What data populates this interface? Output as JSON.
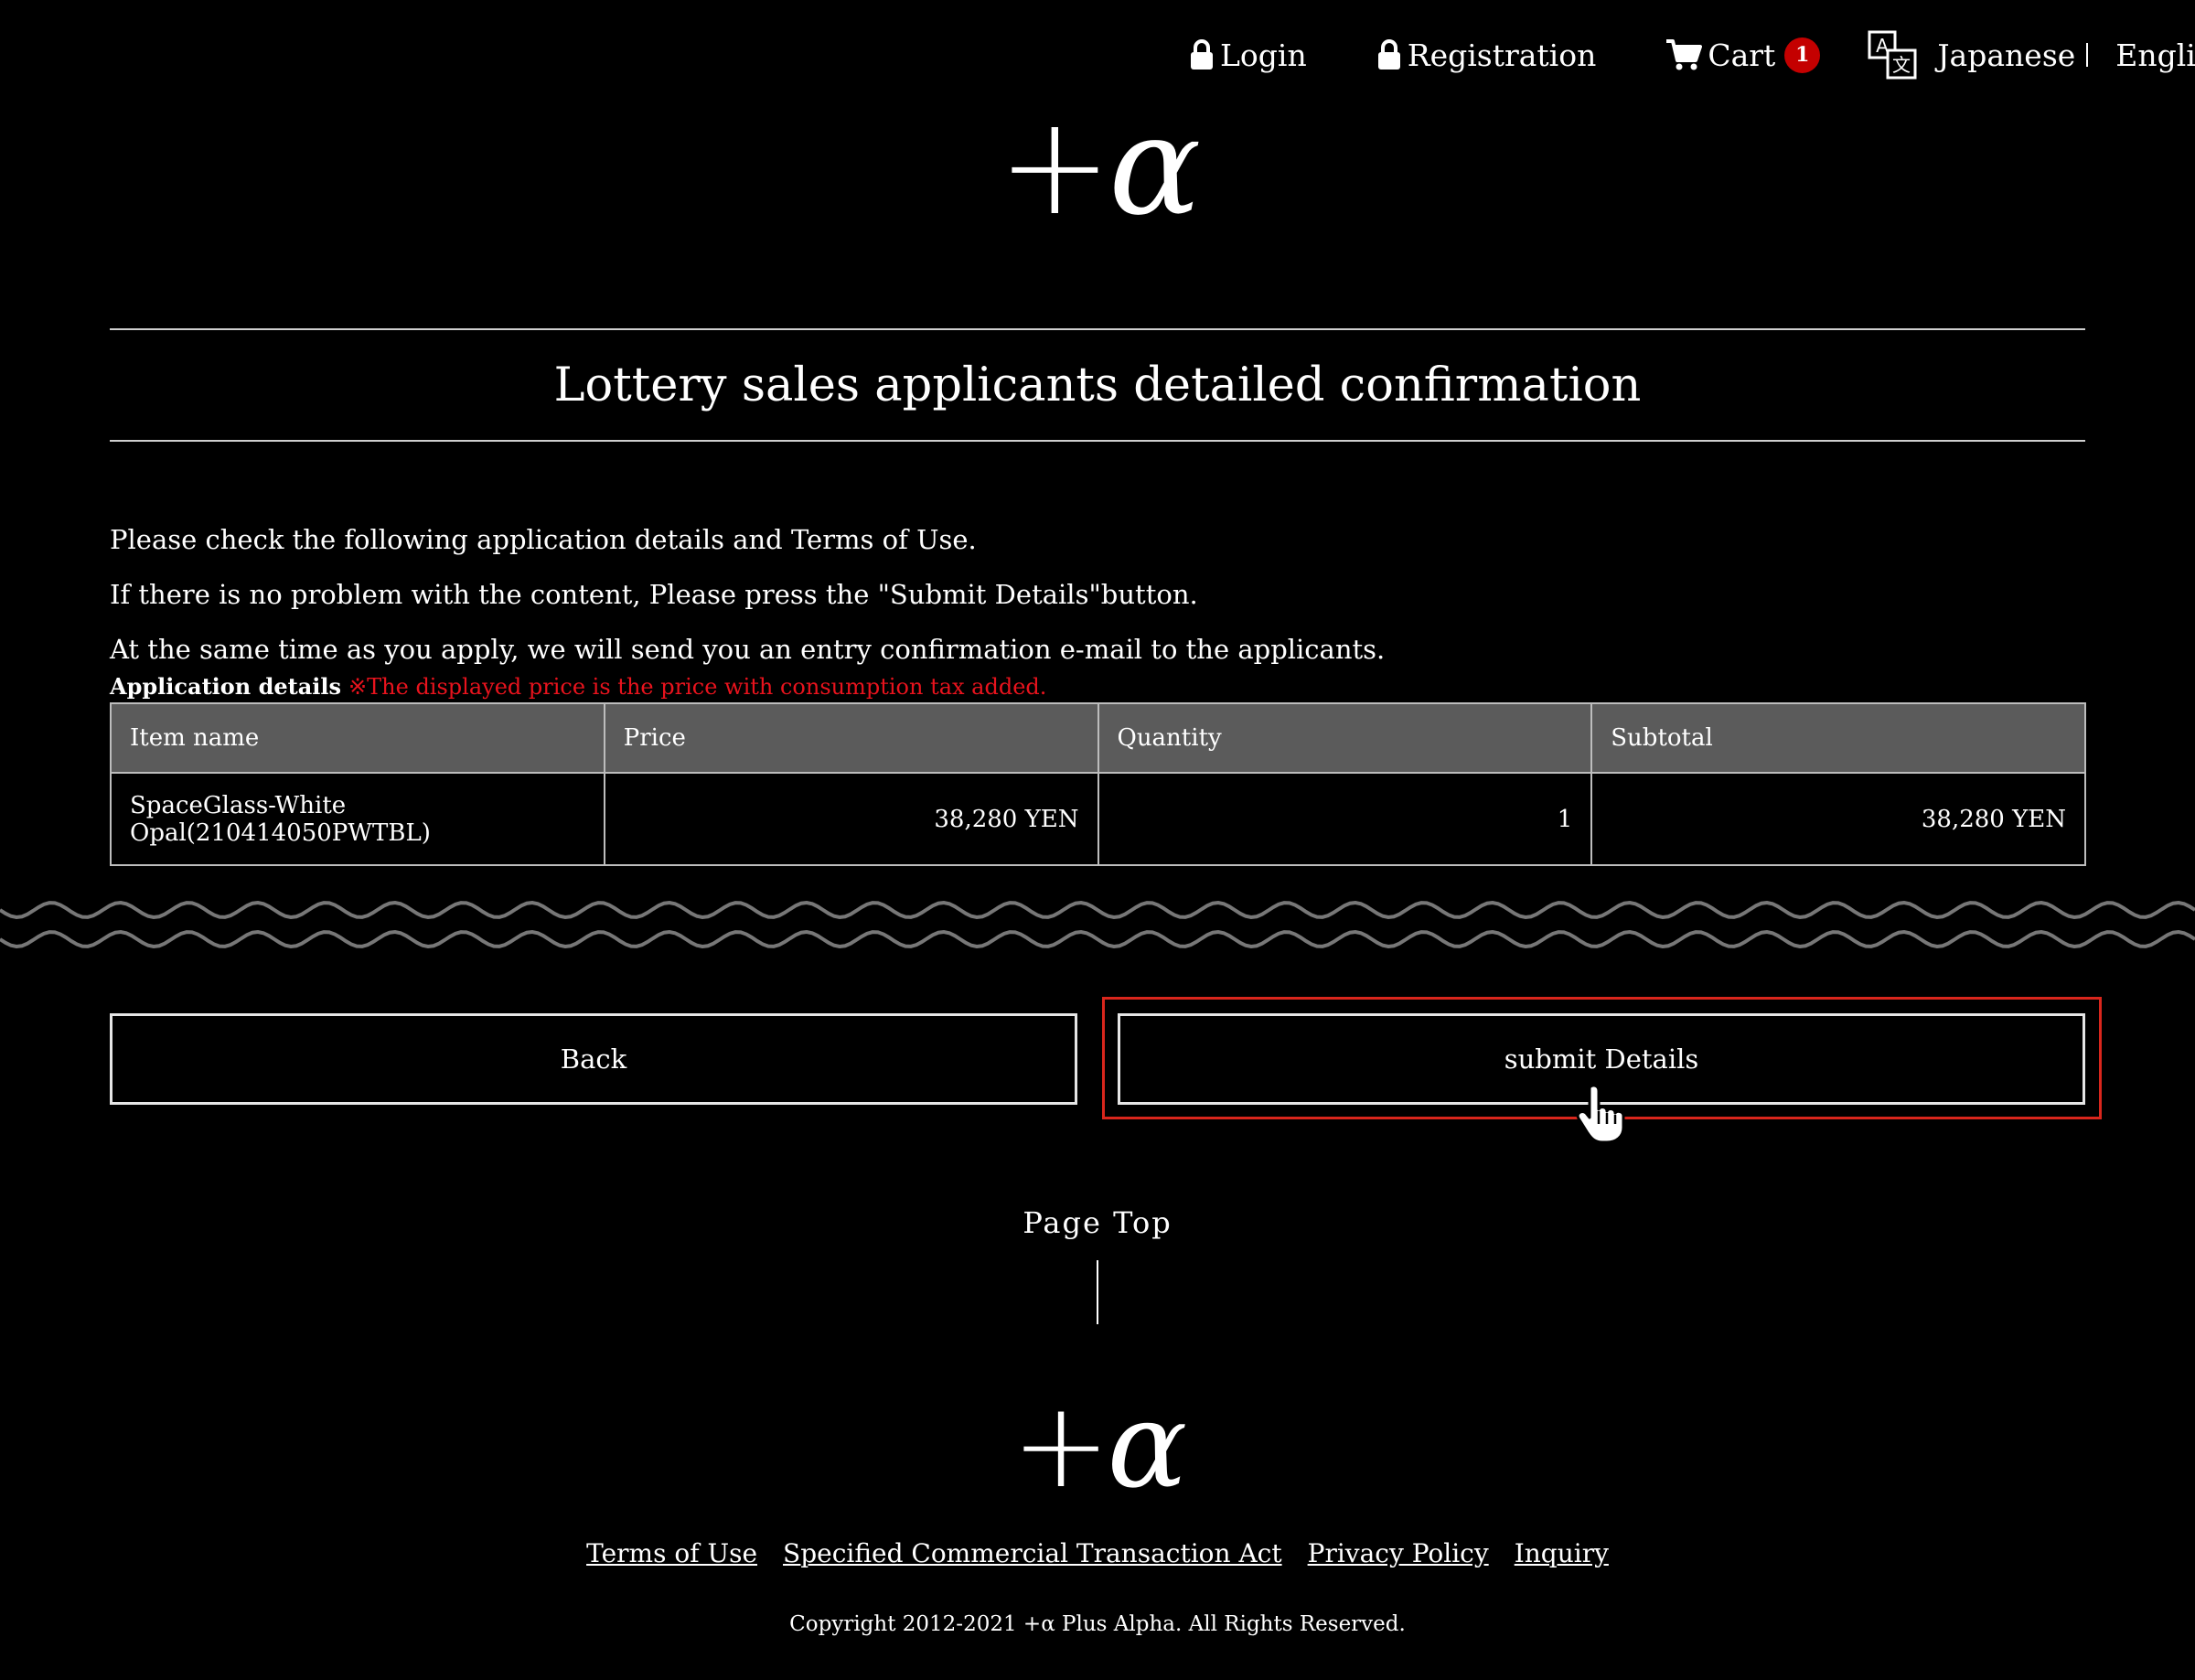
{
  "nav": {
    "login": "Login",
    "registration": "Registration",
    "cart": "Cart",
    "cart_count": "1",
    "lang_japanese": "Japanese",
    "lang_english": "English"
  },
  "logo": {
    "plus": "+",
    "alpha": "α"
  },
  "page_title": "Lottery sales applicants detailed confirmation",
  "instructions": [
    "Please check the following application details and Terms of Use.",
    "If there is no problem with the content, Please press the \"Submit Details\"button.",
    "At the same time as you apply, we will send you an entry confirmation e-mail to the applicants."
  ],
  "details": {
    "label": "Application details",
    "tax_note": "※The displayed price is the price with consumption tax added."
  },
  "table": {
    "headers": [
      "Item name",
      "Price",
      "Quantity",
      "Subtotal"
    ],
    "rows": [
      [
        "SpaceGlass-White Opal(210414050PWTBL)",
        "38,280 YEN",
        "1",
        "38,280 YEN"
      ]
    ]
  },
  "buttons": {
    "back": "Back",
    "submit": "submit Details"
  },
  "page_top": "Page Top",
  "footer": {
    "links": [
      "Terms of Use",
      "Specified Commercial Transaction Act",
      "Privacy Policy",
      "Inquiry"
    ],
    "copyright": "Copyright 2012-2021 +α Plus Alpha. All Rights Reserved."
  },
  "colors": {
    "background": "#000000",
    "table_header": "#5b5b5b",
    "badge": "#c40000",
    "note_red": "#e8131d",
    "highlight": "#d9261c"
  }
}
